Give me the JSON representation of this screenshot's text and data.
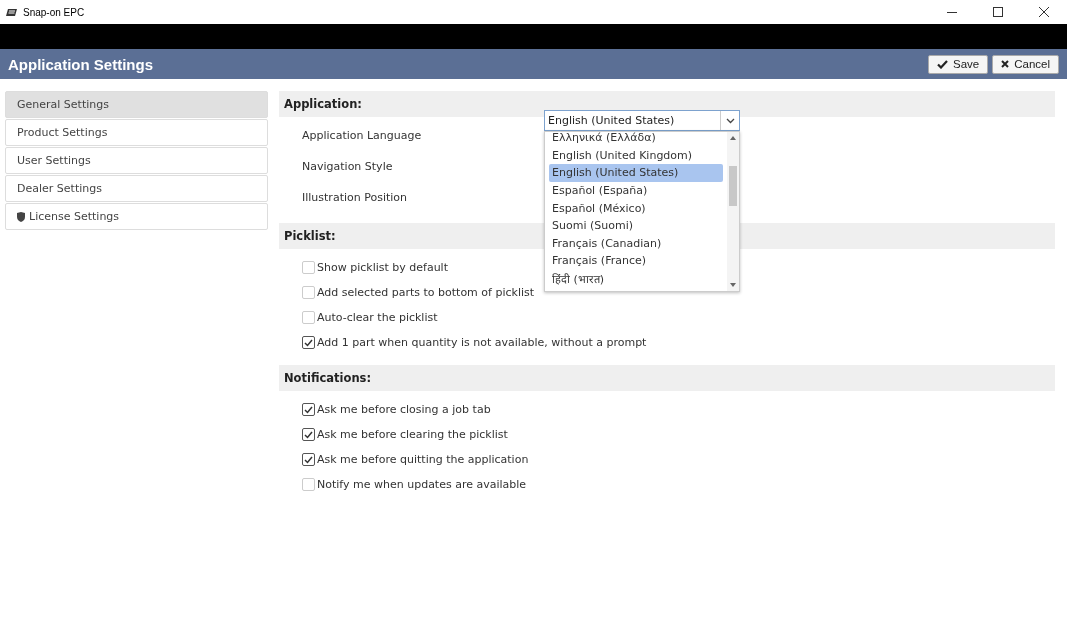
{
  "window": {
    "title": "Snap-on EPC"
  },
  "header": {
    "title": "Application Settings",
    "buttons": [
      {
        "kind": "save",
        "label": "Save"
      },
      {
        "kind": "cancel",
        "label": "Cancel"
      }
    ]
  },
  "sidebar": {
    "items": [
      {
        "label": "General Settings",
        "selected": true,
        "kind": "plain"
      },
      {
        "label": "Product Settings",
        "selected": false,
        "kind": "plain"
      },
      {
        "label": "User Settings",
        "selected": false,
        "kind": "plain"
      },
      {
        "label": "Dealer Settings",
        "selected": false,
        "kind": "plain"
      },
      {
        "label": "License Settings",
        "selected": false,
        "kind": "shield"
      }
    ]
  },
  "application": {
    "title": "Application:",
    "fields": [
      {
        "label": "Application Language"
      },
      {
        "label": "Navigation Style"
      },
      {
        "label": "Illustration Position"
      }
    ],
    "language_select": {
      "value": "English (United States)",
      "expanded": true,
      "options": [
        {
          "label": "Ελληνικά (Ελλάδα)",
          "selected": false
        },
        {
          "label": "English (United Kingdom)",
          "selected": false
        },
        {
          "label": "English (United States)",
          "selected": true
        },
        {
          "label": "Español (España)",
          "selected": false
        },
        {
          "label": "Español (México)",
          "selected": false
        },
        {
          "label": "Suomi (Suomi)",
          "selected": false
        },
        {
          "label": "Français (Canadian)",
          "selected": false
        },
        {
          "label": "Français (France)",
          "selected": false
        },
        {
          "label": "हिंदी (भारत)",
          "selected": false
        }
      ]
    }
  },
  "picklist": {
    "title": "Picklist:",
    "options": [
      {
        "label": "Show picklist by default",
        "checked": false
      },
      {
        "label": "Add selected parts to bottom of picklist",
        "checked": false
      },
      {
        "label": "Auto-clear the picklist",
        "checked": false
      },
      {
        "label": "Add 1 part when quantity is not available, without a prompt",
        "checked": true
      }
    ]
  },
  "notifications": {
    "title": "Notifications:",
    "options": [
      {
        "label": "Ask me before closing a job tab",
        "checked": true
      },
      {
        "label": "Ask me before clearing the picklist",
        "checked": true
      },
      {
        "label": "Ask me before quitting the application",
        "checked": true
      },
      {
        "label": "Notify me when updates are available",
        "checked": false
      }
    ]
  }
}
